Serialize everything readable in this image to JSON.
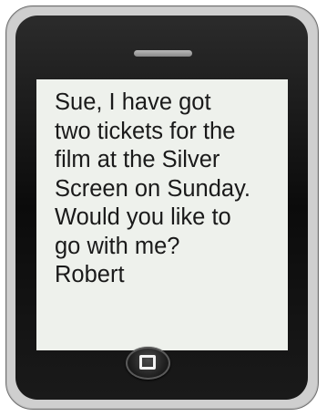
{
  "phone": {
    "message": "Sue, I have got\ntwo tickets for the\nfilm at the Silver\nScreen on Sunday.\nWould you like to\ngo with me?\nRobert",
    "home_button_icon": "square-home-icon",
    "speaker_icon": "speaker-slot-icon",
    "colors": {
      "body": "#cfcfcf",
      "bezel": "#111111",
      "screen": "#eef1ec",
      "text": "#1a1a1a"
    }
  }
}
